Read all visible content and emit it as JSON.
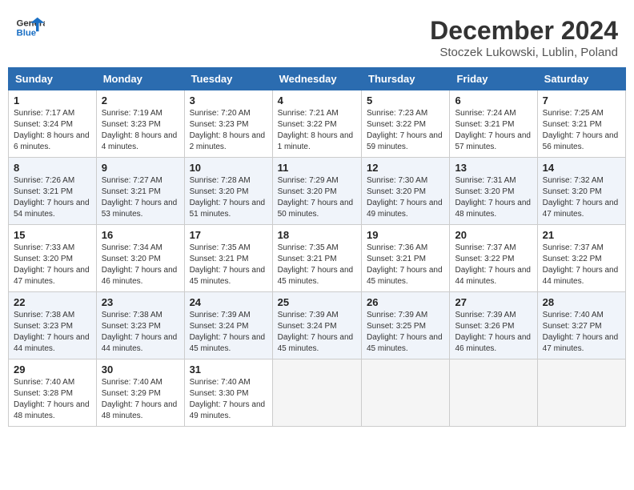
{
  "header": {
    "logo_line1": "General",
    "logo_line2": "Blue",
    "month_title": "December 2024",
    "location": "Stoczek Lukowski, Lublin, Poland"
  },
  "weekdays": [
    "Sunday",
    "Monday",
    "Tuesday",
    "Wednesday",
    "Thursday",
    "Friday",
    "Saturday"
  ],
  "weeks": [
    [
      {
        "day": "1",
        "sunrise": "7:17 AM",
        "sunset": "3:24 PM",
        "daylight": "8 hours and 6 minutes"
      },
      {
        "day": "2",
        "sunrise": "7:19 AM",
        "sunset": "3:23 PM",
        "daylight": "8 hours and 4 minutes"
      },
      {
        "day": "3",
        "sunrise": "7:20 AM",
        "sunset": "3:23 PM",
        "daylight": "8 hours and 2 minutes"
      },
      {
        "day": "4",
        "sunrise": "7:21 AM",
        "sunset": "3:22 PM",
        "daylight": "8 hours and 1 minute"
      },
      {
        "day": "5",
        "sunrise": "7:23 AM",
        "sunset": "3:22 PM",
        "daylight": "7 hours and 59 minutes"
      },
      {
        "day": "6",
        "sunrise": "7:24 AM",
        "sunset": "3:21 PM",
        "daylight": "7 hours and 57 minutes"
      },
      {
        "day": "7",
        "sunrise": "7:25 AM",
        "sunset": "3:21 PM",
        "daylight": "7 hours and 56 minutes"
      }
    ],
    [
      {
        "day": "8",
        "sunrise": "7:26 AM",
        "sunset": "3:21 PM",
        "daylight": "7 hours and 54 minutes"
      },
      {
        "day": "9",
        "sunrise": "7:27 AM",
        "sunset": "3:21 PM",
        "daylight": "7 hours and 53 minutes"
      },
      {
        "day": "10",
        "sunrise": "7:28 AM",
        "sunset": "3:20 PM",
        "daylight": "7 hours and 51 minutes"
      },
      {
        "day": "11",
        "sunrise": "7:29 AM",
        "sunset": "3:20 PM",
        "daylight": "7 hours and 50 minutes"
      },
      {
        "day": "12",
        "sunrise": "7:30 AM",
        "sunset": "3:20 PM",
        "daylight": "7 hours and 49 minutes"
      },
      {
        "day": "13",
        "sunrise": "7:31 AM",
        "sunset": "3:20 PM",
        "daylight": "7 hours and 48 minutes"
      },
      {
        "day": "14",
        "sunrise": "7:32 AM",
        "sunset": "3:20 PM",
        "daylight": "7 hours and 47 minutes"
      }
    ],
    [
      {
        "day": "15",
        "sunrise": "7:33 AM",
        "sunset": "3:20 PM",
        "daylight": "7 hours and 47 minutes"
      },
      {
        "day": "16",
        "sunrise": "7:34 AM",
        "sunset": "3:20 PM",
        "daylight": "7 hours and 46 minutes"
      },
      {
        "day": "17",
        "sunrise": "7:35 AM",
        "sunset": "3:21 PM",
        "daylight": "7 hours and 45 minutes"
      },
      {
        "day": "18",
        "sunrise": "7:35 AM",
        "sunset": "3:21 PM",
        "daylight": "7 hours and 45 minutes"
      },
      {
        "day": "19",
        "sunrise": "7:36 AM",
        "sunset": "3:21 PM",
        "daylight": "7 hours and 45 minutes"
      },
      {
        "day": "20",
        "sunrise": "7:37 AM",
        "sunset": "3:22 PM",
        "daylight": "7 hours and 44 minutes"
      },
      {
        "day": "21",
        "sunrise": "7:37 AM",
        "sunset": "3:22 PM",
        "daylight": "7 hours and 44 minutes"
      }
    ],
    [
      {
        "day": "22",
        "sunrise": "7:38 AM",
        "sunset": "3:23 PM",
        "daylight": "7 hours and 44 minutes"
      },
      {
        "day": "23",
        "sunrise": "7:38 AM",
        "sunset": "3:23 PM",
        "daylight": "7 hours and 44 minutes"
      },
      {
        "day": "24",
        "sunrise": "7:39 AM",
        "sunset": "3:24 PM",
        "daylight": "7 hours and 45 minutes"
      },
      {
        "day": "25",
        "sunrise": "7:39 AM",
        "sunset": "3:24 PM",
        "daylight": "7 hours and 45 minutes"
      },
      {
        "day": "26",
        "sunrise": "7:39 AM",
        "sunset": "3:25 PM",
        "daylight": "7 hours and 45 minutes"
      },
      {
        "day": "27",
        "sunrise": "7:39 AM",
        "sunset": "3:26 PM",
        "daylight": "7 hours and 46 minutes"
      },
      {
        "day": "28",
        "sunrise": "7:40 AM",
        "sunset": "3:27 PM",
        "daylight": "7 hours and 47 minutes"
      }
    ],
    [
      {
        "day": "29",
        "sunrise": "7:40 AM",
        "sunset": "3:28 PM",
        "daylight": "7 hours and 48 minutes"
      },
      {
        "day": "30",
        "sunrise": "7:40 AM",
        "sunset": "3:29 PM",
        "daylight": "7 hours and 48 minutes"
      },
      {
        "day": "31",
        "sunrise": "7:40 AM",
        "sunset": "3:30 PM",
        "daylight": "7 hours and 49 minutes"
      },
      null,
      null,
      null,
      null
    ]
  ]
}
